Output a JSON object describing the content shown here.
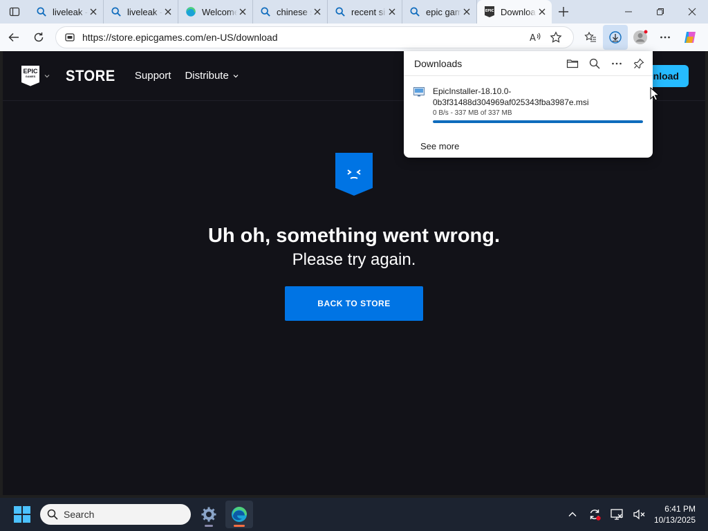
{
  "browser": {
    "tabs": [
      {
        "title": "liveleak -",
        "icon": "search-icon",
        "active": false
      },
      {
        "title": "liveleak -",
        "icon": "search-icon",
        "active": false
      },
      {
        "title": "Welcome",
        "icon": "edge-icon",
        "active": false
      },
      {
        "title": "chinese s",
        "icon": "search-icon",
        "active": false
      },
      {
        "title": "recent si",
        "icon": "search-icon",
        "active": false
      },
      {
        "title": "epic gam",
        "icon": "search-icon",
        "active": false
      },
      {
        "title": "Downloa",
        "icon": "epic-games-icon",
        "active": true
      }
    ],
    "url": "https://store.epicgames.com/en-US/download",
    "accent": "#0f6cbd"
  },
  "epic_nav": {
    "logo_line1": "EPIC",
    "logo_line2": "GAMES",
    "store": "STORE",
    "support": "Support",
    "distribute": "Distribute",
    "download_cta": "nload"
  },
  "error": {
    "title": "Uh oh, something went wrong.",
    "subtitle": "Please try again.",
    "button": "BACK TO STORE",
    "shield_color": "#0074e4"
  },
  "downloads": {
    "title": "Downloads",
    "file_name": "EpicInstaller-18.10.0-0b3f31488d304969af025343fba3987e.msi",
    "status": "0 B/s - 337 MB of 337 MB",
    "progress_percent": 100,
    "see_more": "See more"
  },
  "taskbar": {
    "search_placeholder": "Search",
    "time": "6:41 PM",
    "date": "10/13/2025"
  }
}
